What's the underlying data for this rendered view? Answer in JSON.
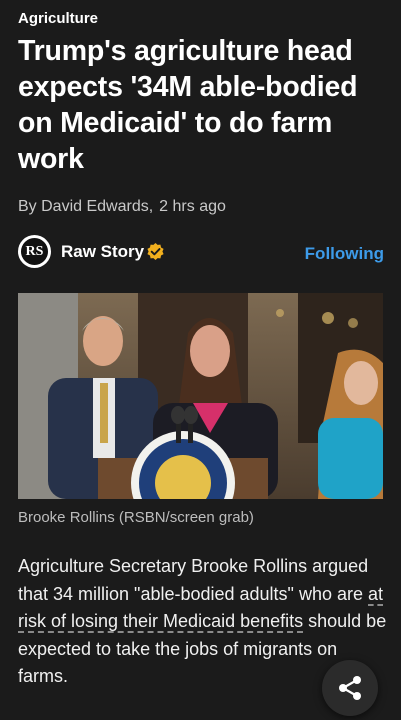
{
  "article": {
    "category": "Agriculture",
    "headline": "Trump's agriculture head expects '34M able-bodied on Medicaid' to do farm work",
    "author": "By David Edwards,",
    "time": "2 hrs ago"
  },
  "source": {
    "name": "Raw Story",
    "logo_text": "RS",
    "follow_label": "Following"
  },
  "photo": {
    "caption": "Brooke Rollins (RSBN/screen grab)"
  },
  "body": {
    "part1": "Agriculture Secretary Brooke Rollins argued that 34 million \"able-bodied adults\" who are ",
    "link_text": "at risk of losing their Medicaid benefits",
    "part2": " should be expected to take the jobs of migrants on farms."
  },
  "colors": {
    "background": "#1b1b1b",
    "accent": "#3d9be9",
    "verified_badge": "#f2b01e"
  },
  "icons": {
    "verified": "verified-check-icon",
    "share": "share-icon"
  }
}
